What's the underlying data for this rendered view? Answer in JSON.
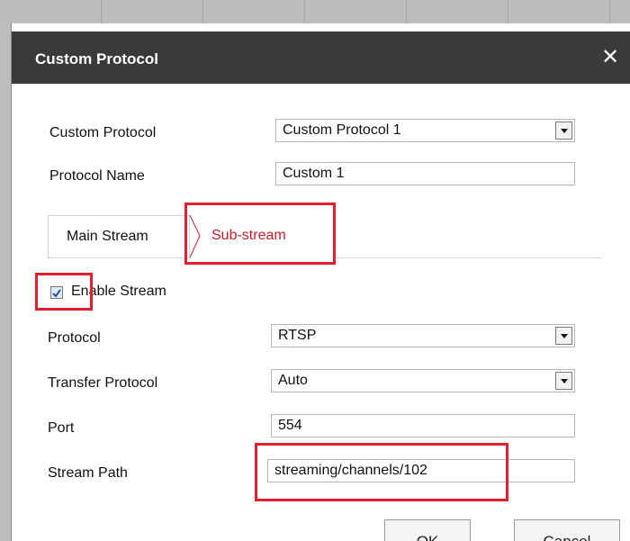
{
  "dialog": {
    "title": "Custom Protocol",
    "close_icon": "close-icon",
    "close_glyph": "✕"
  },
  "form": {
    "custom_protocol": {
      "label": "Custom Protocol",
      "value": "Custom Protocol 1"
    },
    "protocol_name": {
      "label": "Protocol Name",
      "value": "Custom 1"
    }
  },
  "tabs": {
    "main": "Main Stream",
    "sub": "Sub-stream",
    "active": "Sub-stream"
  },
  "stream": {
    "enable": {
      "label": "Enable Stream",
      "checked": true
    },
    "protocol": {
      "label": "Protocol",
      "value": "RTSP"
    },
    "transfer_protocol": {
      "label": "Transfer Protocol",
      "value": "Auto"
    },
    "port": {
      "label": "Port",
      "value": "554"
    },
    "stream_path": {
      "label": "Stream Path",
      "value": "streaming/channels/102"
    }
  },
  "buttons": {
    "ok": "OK",
    "cancel": "Cancel"
  },
  "colors": {
    "titlebar": "#3a3a3a",
    "highlight": "#e0202e",
    "active_tab_text": "#c41e2b",
    "checkbox_fill": "#dfe8f6",
    "checkmark": "#2b4ea8"
  }
}
